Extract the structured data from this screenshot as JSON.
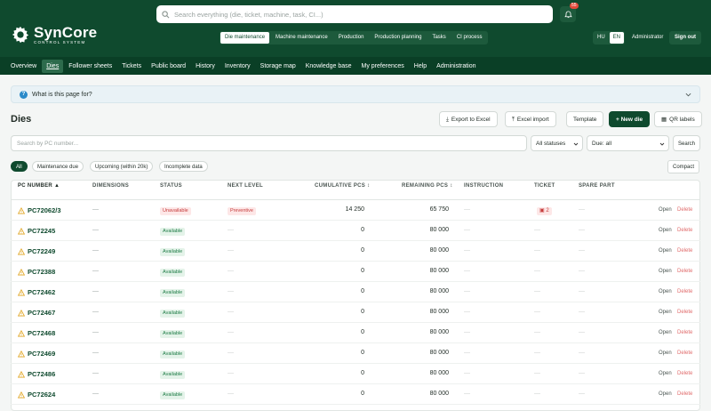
{
  "header": {
    "logo_name": "SynCore",
    "logo_sub": "CONTROL SYSTEM",
    "search_placeholder": "Search everything (die, ticket, machine, task, CI...)",
    "notification_count": "55",
    "modules": [
      "Die maintenance",
      "Machine maintenance",
      "Production",
      "Production planning",
      "Tasks",
      "CI process"
    ],
    "active_module": 0,
    "languages": [
      "HU",
      "EN"
    ],
    "active_language": 1,
    "user": "Administrator",
    "signout": "Sign out"
  },
  "nav": {
    "items": [
      "Overview",
      "Dies",
      "Follower sheets",
      "Tickets",
      "Public board",
      "History",
      "Inventory",
      "Storage map",
      "Knowledge base",
      "My preferences",
      "Help",
      "Administration"
    ],
    "active": 1
  },
  "info": {
    "text": "What is this page for?"
  },
  "page": {
    "title": "Dies",
    "actions": {
      "export": "Export to Excel",
      "import": "Excel import",
      "template": "Template",
      "new_die": "+ New die",
      "qr": "QR labels"
    }
  },
  "filters": {
    "search_placeholder": "Search by PC number...",
    "status_value": "All statuses",
    "due_value": "Due: all",
    "search_button": "Search",
    "chips": [
      "All",
      "Maintenance due",
      "Upcoming (within 20k)",
      "Incomplete data"
    ],
    "active_chip": 0,
    "compact": "Compact"
  },
  "table": {
    "columns": [
      "PC NUMBER ▲",
      "DIMENSIONS",
      "STATUS",
      "NEXT LEVEL",
      "CUMULATIVE PCS ↕",
      "REMAINING PCS ↕",
      "INSTRUCTION",
      "TICKET",
      "SPARE PART"
    ],
    "open_label": "Open",
    "delete_label": "Delete",
    "rows": [
      {
        "pc": "PC72062/3",
        "dimensions": "—",
        "status": "Unavailable",
        "status_type": "un",
        "next_level": "Preventive",
        "cumulative": "14 250",
        "remaining": "65 750",
        "instruction": "—",
        "ticket": "2",
        "spare": "—"
      },
      {
        "pc": "PC72245",
        "dimensions": "—",
        "status": "Available",
        "status_type": "av",
        "next_level": "—",
        "cumulative": "0",
        "remaining": "80 000",
        "instruction": "—",
        "ticket": "",
        "spare": "—"
      },
      {
        "pc": "PC72249",
        "dimensions": "—",
        "status": "Available",
        "status_type": "av",
        "next_level": "—",
        "cumulative": "0",
        "remaining": "80 000",
        "instruction": "—",
        "ticket": "",
        "spare": "—"
      },
      {
        "pc": "PC72388",
        "dimensions": "—",
        "status": "Available",
        "status_type": "av",
        "next_level": "—",
        "cumulative": "0",
        "remaining": "80 000",
        "instruction": "—",
        "ticket": "",
        "spare": "—"
      },
      {
        "pc": "PC72462",
        "dimensions": "—",
        "status": "Available",
        "status_type": "av",
        "next_level": "—",
        "cumulative": "0",
        "remaining": "80 000",
        "instruction": "—",
        "ticket": "",
        "spare": "—"
      },
      {
        "pc": "PC72467",
        "dimensions": "—",
        "status": "Available",
        "status_type": "av",
        "next_level": "—",
        "cumulative": "0",
        "remaining": "80 000",
        "instruction": "—",
        "ticket": "",
        "spare": "—"
      },
      {
        "pc": "PC72468",
        "dimensions": "—",
        "status": "Available",
        "status_type": "av",
        "next_level": "—",
        "cumulative": "0",
        "remaining": "80 000",
        "instruction": "—",
        "ticket": "",
        "spare": "—"
      },
      {
        "pc": "PC72469",
        "dimensions": "—",
        "status": "Available",
        "status_type": "av",
        "next_level": "—",
        "cumulative": "0",
        "remaining": "80 000",
        "instruction": "—",
        "ticket": "",
        "spare": "—"
      },
      {
        "pc": "PC72486",
        "dimensions": "—",
        "status": "Available",
        "status_type": "av",
        "next_level": "—",
        "cumulative": "0",
        "remaining": "80 000",
        "instruction": "—",
        "ticket": "",
        "spare": "—"
      },
      {
        "pc": "PC72624",
        "dimensions": "—",
        "status": "Available",
        "status_type": "av",
        "next_level": "—",
        "cumulative": "0",
        "remaining": "80 000",
        "instruction": "—",
        "ticket": "",
        "spare": "—"
      }
    ]
  },
  "colors": {
    "brand": "#0f4a2e",
    "accent_red": "#c63c3c",
    "available_green": "#1e7c46",
    "warning": "#e0a41f"
  }
}
